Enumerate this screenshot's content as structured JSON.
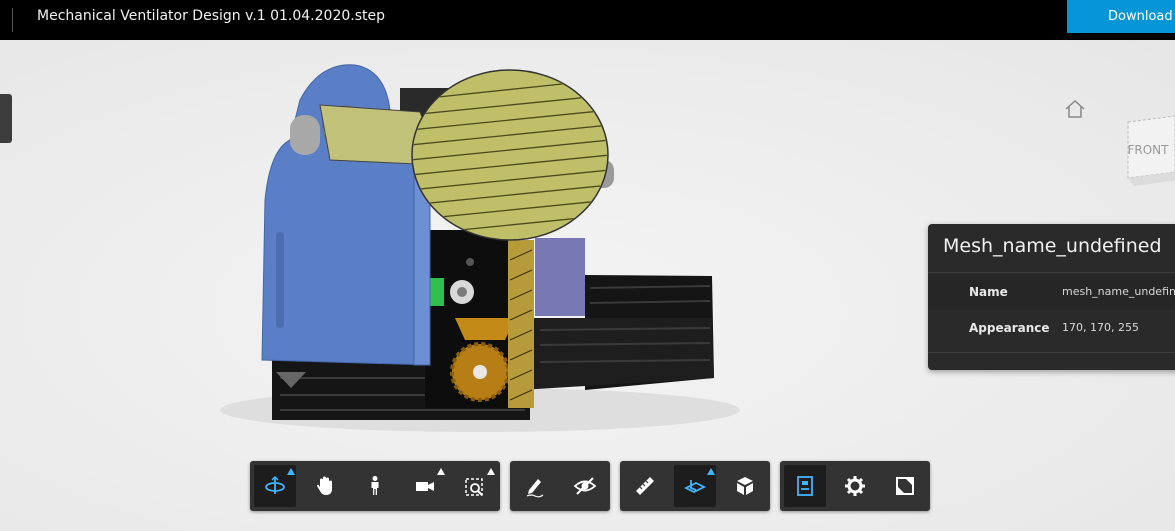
{
  "header": {
    "title": "Mechanical Ventilator Design v.1 01.04.2020.step",
    "download_label": "Download"
  },
  "viewcube": {
    "face_label": "FRONT"
  },
  "properties": {
    "title": "Mesh_name_undefined",
    "rows": [
      {
        "label": "Name",
        "value": "mesh_name_undefined"
      },
      {
        "label": "Appearance",
        "value": "170, 170, 255"
      }
    ]
  },
  "toolbar": {
    "groups": [
      [
        "orbit-tool",
        "pan-tool",
        "first-person-tool",
        "camera-tool",
        "fit-to-view-tool"
      ],
      [
        "markup-tool",
        "hide-tool"
      ],
      [
        "measure-tool",
        "section-tool",
        "explode-tool"
      ],
      [
        "model-browser-tool",
        "settings-tool",
        "fullscreen-tool"
      ]
    ]
  },
  "colors": {
    "accent": "#0696d7",
    "active_icon": "#3fb5ff",
    "mesh_blue": "#aaaaff",
    "panel_bg": "#2a2a2a"
  }
}
